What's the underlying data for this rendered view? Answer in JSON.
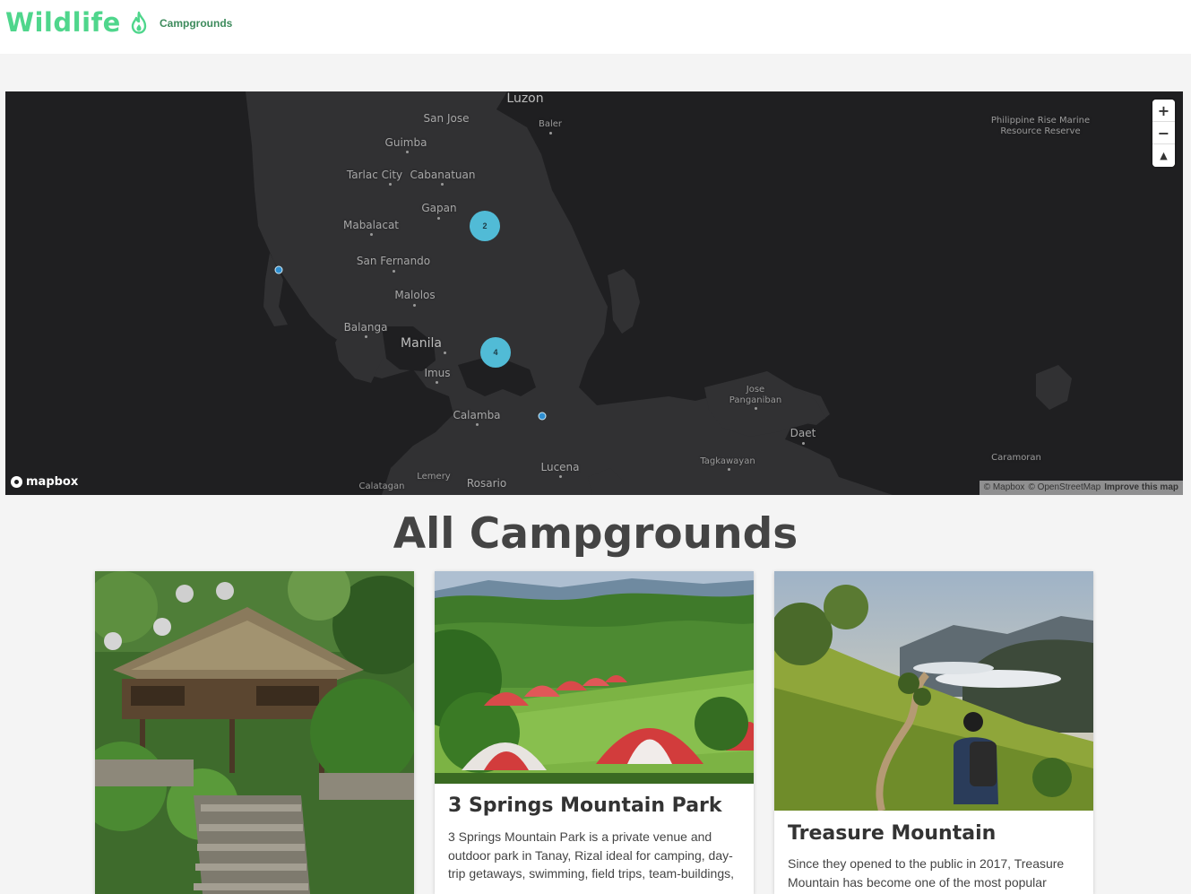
{
  "navbar": {
    "brand": "Wildlife",
    "brand_icon": "flame-icon",
    "links": [
      "Campgrounds"
    ]
  },
  "map": {
    "places": {
      "luzon": "Luzon",
      "san_jose": "San Jose",
      "baler": "Baler",
      "guimba": "Guimba",
      "tarlac": "Tarlac City",
      "cabanatuan": "Cabanatuan",
      "gapan": "Gapan",
      "mabalacat": "Mabalacat",
      "san_fernando": "San Fernando",
      "malolos": "Malolos",
      "balanga": "Balanga",
      "manila": "Manila",
      "imus": "Imus",
      "calamba": "Calamba",
      "lucena": "Lucena",
      "rosario": "Rosario",
      "lemery": "Lemery",
      "calatagan": "Calatagan",
      "tagkawayan": "Tagkawayan",
      "daet": "Daet",
      "caramoran": "Caramoran",
      "jose_panganiban_1": "Jose",
      "jose_panganiban_2": "Panganiban",
      "reserve_1": "Philippine Rise Marine",
      "reserve_2": "Resource Reserve"
    },
    "clusters": [
      "2",
      "4"
    ],
    "controls": {
      "zoom_in": "+",
      "zoom_out": "−",
      "compass": "▲"
    },
    "logo": "mapbox",
    "attribution": {
      "mapbox": "© Mapbox",
      "osm": "© OpenStreetMap",
      "improve": "Improve this map"
    },
    "colors": {
      "background": "#1f1f21",
      "land": "#313133",
      "cluster": "#51bbd6",
      "point": "#2f8fd1"
    }
  },
  "main": {
    "title": "All Campgrounds"
  },
  "cards": [
    {
      "title": "",
      "description": ""
    },
    {
      "title": "3 Springs Mountain Park",
      "description": "3 Springs Mountain Park is a private venue and outdoor park in Tanay, Rizal ideal for camping, day-trip getaways, swimming, field trips, team-buildings,"
    },
    {
      "title": "Treasure Mountain",
      "description": "Since they opened to the public in 2017, Treasure Mountain has become one of the most popular"
    }
  ]
}
